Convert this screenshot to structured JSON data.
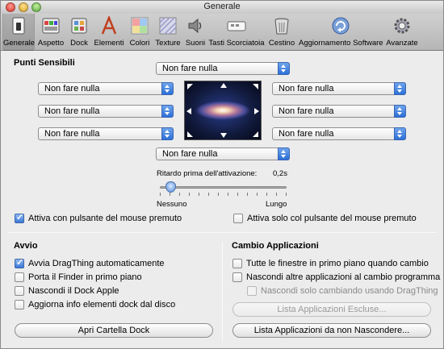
{
  "window": {
    "title": "Generale"
  },
  "toolbar": {
    "items": [
      {
        "label": "Generale",
        "icon": "general-switch-icon",
        "selected": true
      },
      {
        "label": "Aspetto",
        "icon": "appearance-icon"
      },
      {
        "label": "Dock",
        "icon": "dock-icon"
      },
      {
        "label": "Elementi",
        "icon": "elements-icon"
      },
      {
        "label": "Colori",
        "icon": "colors-icon"
      },
      {
        "label": "Texture",
        "icon": "texture-icon"
      },
      {
        "label": "Suoni",
        "icon": "speaker-icon"
      },
      {
        "label": "Tasti Scorciatoia",
        "icon": "keyboard-icon"
      },
      {
        "label": "Cestino",
        "icon": "trash-icon"
      },
      {
        "label": "Aggiornamento Software",
        "icon": "update-icon"
      },
      {
        "label": "Avanzate",
        "icon": "gear-icon"
      }
    ]
  },
  "hot_corners": {
    "section_title": "Punti Sensibili",
    "top": "Non fare nulla",
    "left_top": "Non fare nulla",
    "left_middle": "Non fare nulla",
    "left_bottom": "Non fare nulla",
    "right_top": "Non fare nulla",
    "right_middle": "Non fare nulla",
    "right_bottom": "Non fare nulla",
    "bottom": "Non fare nulla",
    "delay_label": "Ritardo prima dell'attivazione:",
    "delay_value": "0,2s",
    "delay_fraction": 0.05,
    "slider_min_label": "Nessuno",
    "slider_max_label": "Lungo",
    "activate_with_mouse": "Attiva con pulsante del mouse premuto",
    "activate_only_mouse": "Attiva solo col pulsante del mouse premuto"
  },
  "startup": {
    "section_title": "Avvio",
    "options": [
      {
        "label": "Avvia DragThing automaticamente",
        "checked": true
      },
      {
        "label": "Porta il Finder in primo piano",
        "checked": false
      },
      {
        "label": "Nascondi il Dock Apple",
        "checked": false
      },
      {
        "label": "Aggiorna info elementi dock dal disco",
        "checked": false
      }
    ],
    "open_dock_folder_button": "Apri Cartella Dock"
  },
  "app_switching": {
    "section_title": "Cambio Applicazioni",
    "options": [
      {
        "label": "Tutte le finestre in primo piano quando cambio",
        "checked": false
      },
      {
        "label": "Nascondi altre applicazioni al cambio programma",
        "checked": false
      },
      {
        "label": "Nascondi solo cambiando usando DragThing",
        "checked": false,
        "disabled": true
      }
    ],
    "excluded_list_button": "Lista Applicazioni Escluse...",
    "do_not_hide_list_button": "Lista Applicazioni da non Nascondere..."
  }
}
